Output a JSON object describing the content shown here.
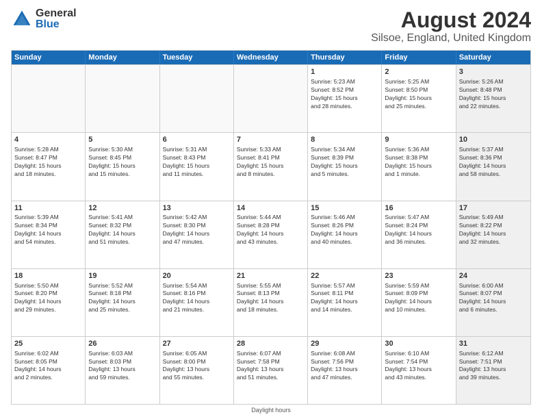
{
  "logo": {
    "general": "General",
    "blue": "Blue"
  },
  "title": "August 2024",
  "subtitle": "Silsoe, England, United Kingdom",
  "days": [
    "Sunday",
    "Monday",
    "Tuesday",
    "Wednesday",
    "Thursday",
    "Friday",
    "Saturday"
  ],
  "footer": "Daylight hours",
  "weeks": [
    [
      {
        "day": "",
        "text": "",
        "empty": true
      },
      {
        "day": "",
        "text": "",
        "empty": true
      },
      {
        "day": "",
        "text": "",
        "empty": true
      },
      {
        "day": "",
        "text": "",
        "empty": true
      },
      {
        "day": "1",
        "text": "Sunrise: 5:23 AM\nSunset: 8:52 PM\nDaylight: 15 hours\nand 28 minutes.",
        "empty": false
      },
      {
        "day": "2",
        "text": "Sunrise: 5:25 AM\nSunset: 8:50 PM\nDaylight: 15 hours\nand 25 minutes.",
        "empty": false
      },
      {
        "day": "3",
        "text": "Sunrise: 5:26 AM\nSunset: 8:48 PM\nDaylight: 15 hours\nand 22 minutes.",
        "empty": false,
        "shaded": true
      }
    ],
    [
      {
        "day": "4",
        "text": "Sunrise: 5:28 AM\nSunset: 8:47 PM\nDaylight: 15 hours\nand 18 minutes.",
        "empty": false
      },
      {
        "day": "5",
        "text": "Sunrise: 5:30 AM\nSunset: 8:45 PM\nDaylight: 15 hours\nand 15 minutes.",
        "empty": false
      },
      {
        "day": "6",
        "text": "Sunrise: 5:31 AM\nSunset: 8:43 PM\nDaylight: 15 hours\nand 11 minutes.",
        "empty": false
      },
      {
        "day": "7",
        "text": "Sunrise: 5:33 AM\nSunset: 8:41 PM\nDaylight: 15 hours\nand 8 minutes.",
        "empty": false
      },
      {
        "day": "8",
        "text": "Sunrise: 5:34 AM\nSunset: 8:39 PM\nDaylight: 15 hours\nand 5 minutes.",
        "empty": false
      },
      {
        "day": "9",
        "text": "Sunrise: 5:36 AM\nSunset: 8:38 PM\nDaylight: 15 hours\nand 1 minute.",
        "empty": false
      },
      {
        "day": "10",
        "text": "Sunrise: 5:37 AM\nSunset: 8:36 PM\nDaylight: 14 hours\nand 58 minutes.",
        "empty": false,
        "shaded": true
      }
    ],
    [
      {
        "day": "11",
        "text": "Sunrise: 5:39 AM\nSunset: 8:34 PM\nDaylight: 14 hours\nand 54 minutes.",
        "empty": false
      },
      {
        "day": "12",
        "text": "Sunrise: 5:41 AM\nSunset: 8:32 PM\nDaylight: 14 hours\nand 51 minutes.",
        "empty": false
      },
      {
        "day": "13",
        "text": "Sunrise: 5:42 AM\nSunset: 8:30 PM\nDaylight: 14 hours\nand 47 minutes.",
        "empty": false
      },
      {
        "day": "14",
        "text": "Sunrise: 5:44 AM\nSunset: 8:28 PM\nDaylight: 14 hours\nand 43 minutes.",
        "empty": false
      },
      {
        "day": "15",
        "text": "Sunrise: 5:46 AM\nSunset: 8:26 PM\nDaylight: 14 hours\nand 40 minutes.",
        "empty": false
      },
      {
        "day": "16",
        "text": "Sunrise: 5:47 AM\nSunset: 8:24 PM\nDaylight: 14 hours\nand 36 minutes.",
        "empty": false
      },
      {
        "day": "17",
        "text": "Sunrise: 5:49 AM\nSunset: 8:22 PM\nDaylight: 14 hours\nand 32 minutes.",
        "empty": false,
        "shaded": true
      }
    ],
    [
      {
        "day": "18",
        "text": "Sunrise: 5:50 AM\nSunset: 8:20 PM\nDaylight: 14 hours\nand 29 minutes.",
        "empty": false
      },
      {
        "day": "19",
        "text": "Sunrise: 5:52 AM\nSunset: 8:18 PM\nDaylight: 14 hours\nand 25 minutes.",
        "empty": false
      },
      {
        "day": "20",
        "text": "Sunrise: 5:54 AM\nSunset: 8:16 PM\nDaylight: 14 hours\nand 21 minutes.",
        "empty": false
      },
      {
        "day": "21",
        "text": "Sunrise: 5:55 AM\nSunset: 8:13 PM\nDaylight: 14 hours\nand 18 minutes.",
        "empty": false
      },
      {
        "day": "22",
        "text": "Sunrise: 5:57 AM\nSunset: 8:11 PM\nDaylight: 14 hours\nand 14 minutes.",
        "empty": false
      },
      {
        "day": "23",
        "text": "Sunrise: 5:59 AM\nSunset: 8:09 PM\nDaylight: 14 hours\nand 10 minutes.",
        "empty": false
      },
      {
        "day": "24",
        "text": "Sunrise: 6:00 AM\nSunset: 8:07 PM\nDaylight: 14 hours\nand 6 minutes.",
        "empty": false,
        "shaded": true
      }
    ],
    [
      {
        "day": "25",
        "text": "Sunrise: 6:02 AM\nSunset: 8:05 PM\nDaylight: 14 hours\nand 2 minutes.",
        "empty": false
      },
      {
        "day": "26",
        "text": "Sunrise: 6:03 AM\nSunset: 8:03 PM\nDaylight: 13 hours\nand 59 minutes.",
        "empty": false
      },
      {
        "day": "27",
        "text": "Sunrise: 6:05 AM\nSunset: 8:00 PM\nDaylight: 13 hours\nand 55 minutes.",
        "empty": false
      },
      {
        "day": "28",
        "text": "Sunrise: 6:07 AM\nSunset: 7:58 PM\nDaylight: 13 hours\nand 51 minutes.",
        "empty": false
      },
      {
        "day": "29",
        "text": "Sunrise: 6:08 AM\nSunset: 7:56 PM\nDaylight: 13 hours\nand 47 minutes.",
        "empty": false
      },
      {
        "day": "30",
        "text": "Sunrise: 6:10 AM\nSunset: 7:54 PM\nDaylight: 13 hours\nand 43 minutes.",
        "empty": false
      },
      {
        "day": "31",
        "text": "Sunrise: 6:12 AM\nSunset: 7:51 PM\nDaylight: 13 hours\nand 39 minutes.",
        "empty": false,
        "shaded": true
      }
    ]
  ]
}
